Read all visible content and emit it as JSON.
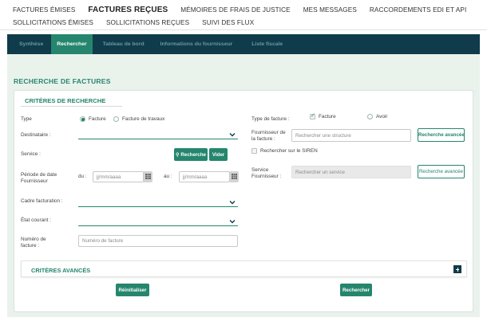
{
  "topnav": {
    "row1": [
      "Factures émises",
      "Factures reçues",
      "Mémoires de frais de justice",
      "Mes messages",
      "Raccordements EDI et API"
    ],
    "row2": [
      "Sollicitations émises",
      "Sollicitations reçues",
      "Suivi des flux"
    ],
    "active": "Factures reçues"
  },
  "tabs": [
    "Synthèse",
    "Rechercher",
    "Tableau de bord",
    "Informations du fournisseur",
    "Liste fiscale"
  ],
  "active_tab": "Rechercher",
  "page_title": "Recherche de factures",
  "criteria": {
    "title": "Critères de recherche",
    "type_label": "Type",
    "type_options": [
      "Facture",
      "Facture de travaux"
    ],
    "destinataire_label": "Destinataire :",
    "service_label": "Service :",
    "search_btn": "Recherche",
    "clear_btn": "Vider",
    "periode_label": "Période de date Fournisseur",
    "du_label": "du :",
    "au_label": "au :",
    "date_placeholder": "jj/mm/aaaa",
    "cadre_label": "Cadre facturation :",
    "etat_label": "État courant :",
    "numero_label": "Numéro de facture :",
    "numero_placeholder": "Numéro de facture",
    "type_facture_label": "Type de facture :",
    "type_facture_options": [
      "Facture",
      "Avoir"
    ],
    "fournisseur_label": "Fournisseur de la facture :",
    "fournisseur_placeholder": "Rechercher une structure",
    "recherche_avancee": "Recherche avancée",
    "siren_label": "Rechercher sur le SIREN",
    "service_fournisseur_label": "Service Fournisseur :",
    "service_placeholder": "Rechercher un service",
    "recherche_avancee2": "Recherche avancée"
  },
  "advanced": {
    "title": "Critères avancés"
  },
  "actions": {
    "reset": "Réinitialiser",
    "search": "Rechercher"
  },
  "colors": {
    "accent": "#25866d",
    "navbar": "#0f3b4a",
    "page_bg": "#eaf2ec"
  },
  "icons": [
    "chevron-down-icon",
    "calendar-icon",
    "search-icon",
    "plus-icon",
    "checkmark-icon"
  ]
}
